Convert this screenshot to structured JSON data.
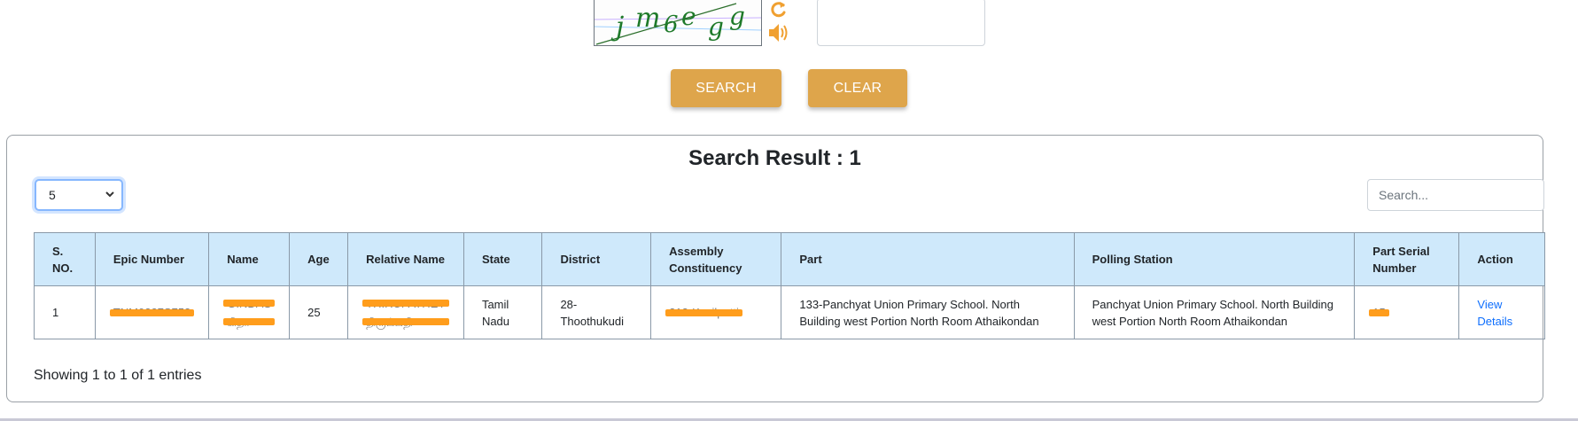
{
  "captcha": {
    "text": "j m6e gg",
    "refresh_icon": "refresh-icon",
    "audio_icon": "speaker-icon",
    "input_value": "",
    "accent": "#f0a030"
  },
  "buttons": {
    "search": "SEARCH",
    "clear": "CLEAR",
    "color": "#dea54b"
  },
  "results": {
    "title": "Search Result : 1",
    "page_size": "5",
    "search_placeholder": "Search...",
    "columns": [
      "S. NO.",
      "Epic Number",
      "Name",
      "Age",
      "Relative Name",
      "State",
      "District",
      "Assembly Constituency",
      "Part",
      "Polling Station",
      "Part Serial Number",
      "Action"
    ],
    "rows": [
      {
        "sno": "1",
        "epic": "TNM0227S753",
        "name_line1": "GINDAS",
        "name_line2": "கிதா",
        "age": "25",
        "relative_line1": "THIRUPATHEY",
        "relative_line2": "திருப்பதி",
        "state": "Tamil Nadu",
        "district": "28-Thoothukudi",
        "assembly": "213-Kovilpatti",
        "part": "133-Panchyat Union Primary School. North Building west Portion North Room Athaikondan",
        "polling_station": "Panchyat Union Primary School. North Building west Portion North Room Athaikondan",
        "part_serial": "15",
        "action": "View Details"
      }
    ],
    "info": "Showing 1 to 1 of 1 entries",
    "header_bg": "#cfe9fb"
  }
}
